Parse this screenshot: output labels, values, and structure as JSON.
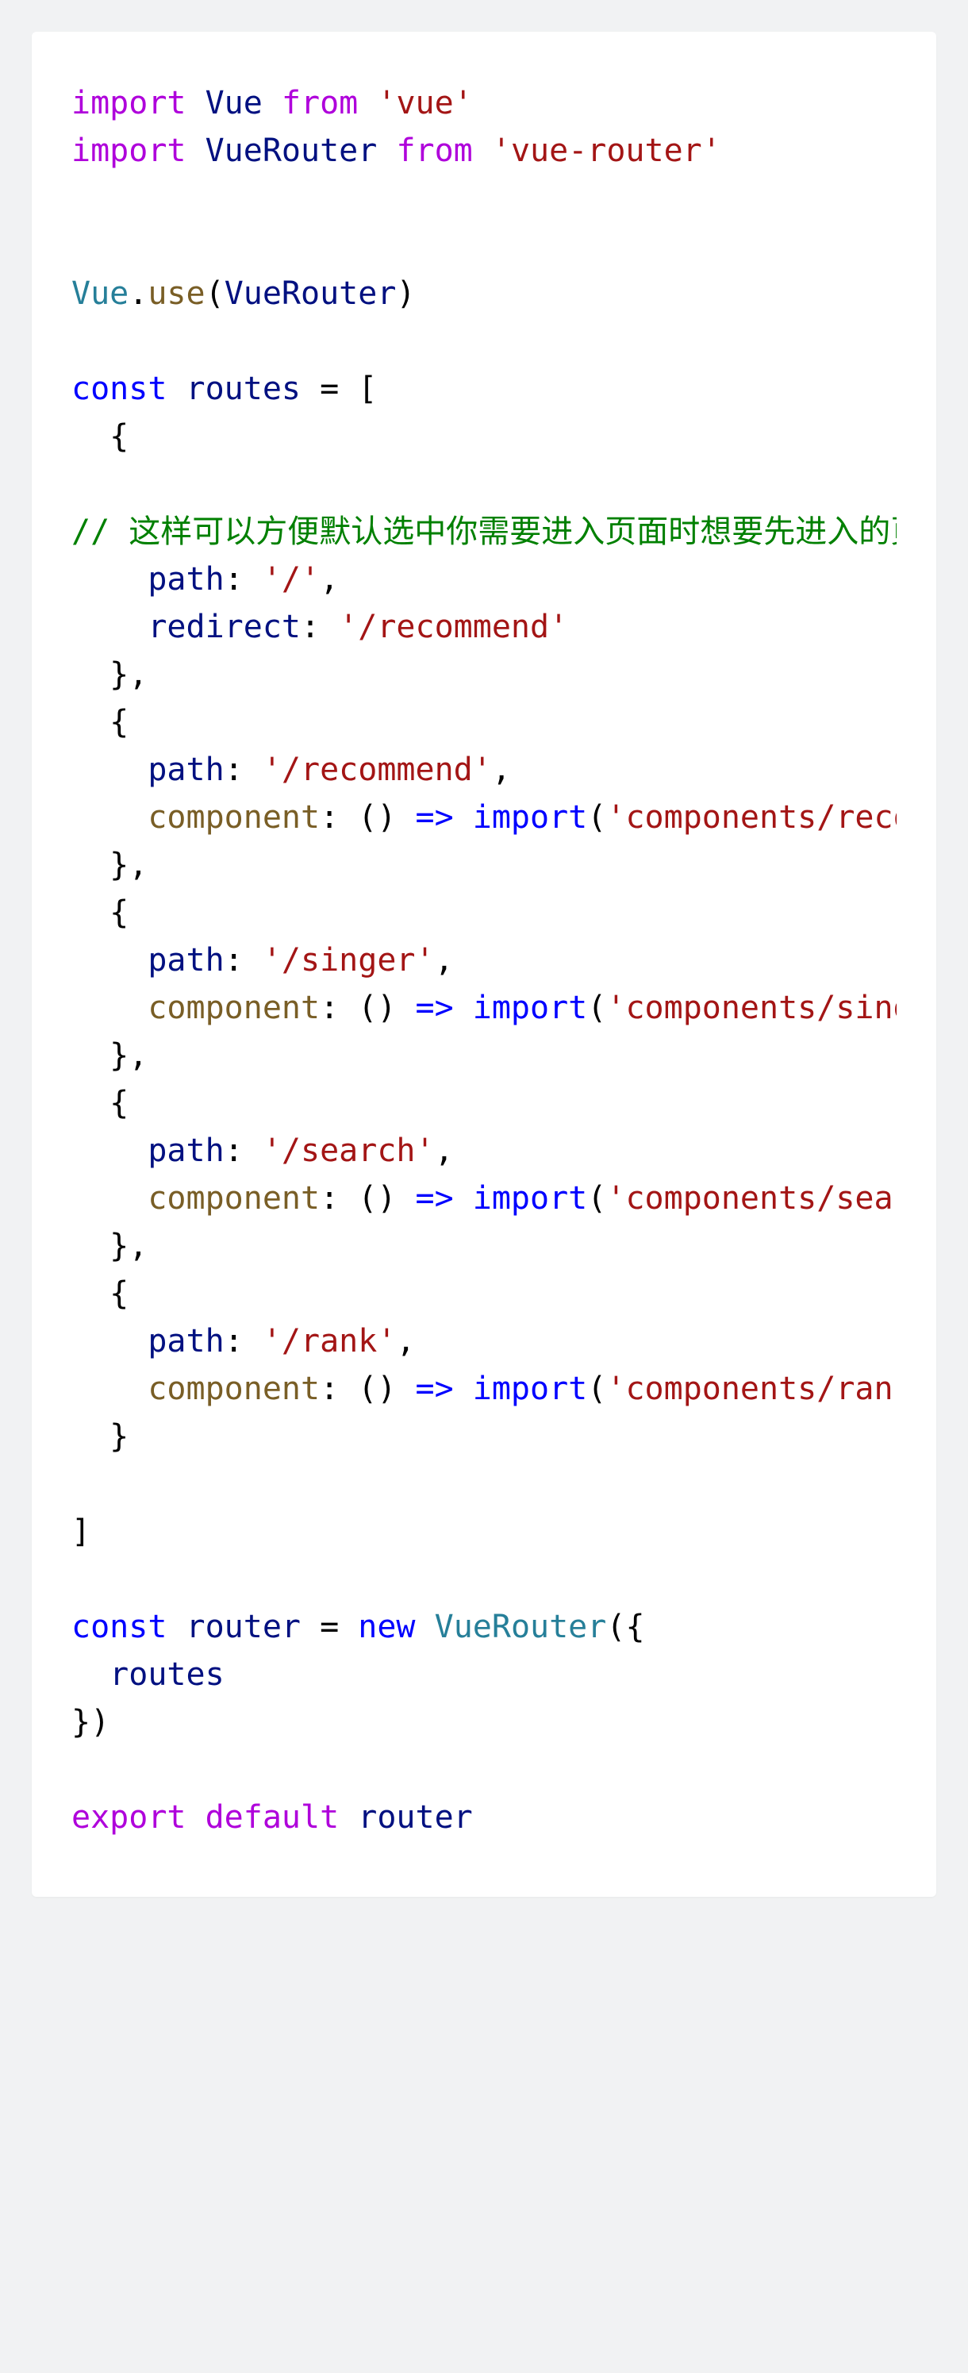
{
  "code": {
    "tokens": [
      {
        "c": "kw-import",
        "t": "import"
      },
      {
        "t": " "
      },
      {
        "c": "var",
        "t": "Vue"
      },
      {
        "t": " "
      },
      {
        "c": "kw-import",
        "t": "from"
      },
      {
        "t": " "
      },
      {
        "c": "str",
        "t": "'vue'"
      },
      {
        "t": "\n"
      },
      {
        "c": "kw-import",
        "t": "import"
      },
      {
        "t": " "
      },
      {
        "c": "var",
        "t": "VueRouter"
      },
      {
        "t": " "
      },
      {
        "c": "kw-import",
        "t": "from"
      },
      {
        "t": " "
      },
      {
        "c": "str",
        "t": "'vue-router'"
      },
      {
        "t": "\n"
      },
      {
        "t": "\n"
      },
      {
        "t": "\n"
      },
      {
        "c": "class",
        "t": "Vue"
      },
      {
        "t": "."
      },
      {
        "c": "fn",
        "t": "use"
      },
      {
        "t": "("
      },
      {
        "c": "var",
        "t": "VueRouter"
      },
      {
        "t": ")"
      },
      {
        "t": "\n"
      },
      {
        "t": "\n"
      },
      {
        "c": "kw-blue",
        "t": "const"
      },
      {
        "t": " "
      },
      {
        "c": "var",
        "t": "routes"
      },
      {
        "t": " = ["
      },
      {
        "t": "\n"
      },
      {
        "t": "  {"
      },
      {
        "t": "\n"
      },
      {
        "t": "\n"
      },
      {
        "c": "cmt",
        "t": "// 这样可以方便默认选中你需要进入页面时想要先进入的页面"
      },
      {
        "t": "\n"
      },
      {
        "t": "    "
      },
      {
        "c": "var",
        "t": "path"
      },
      {
        "t": ": "
      },
      {
        "c": "str",
        "t": "'/'"
      },
      {
        "t": ","
      },
      {
        "t": "\n"
      },
      {
        "t": "    "
      },
      {
        "c": "var",
        "t": "redirect"
      },
      {
        "t": ": "
      },
      {
        "c": "str",
        "t": "'/recommend'"
      },
      {
        "t": "\n"
      },
      {
        "t": "  },"
      },
      {
        "t": "\n"
      },
      {
        "t": "  {"
      },
      {
        "t": "\n"
      },
      {
        "t": "    "
      },
      {
        "c": "var",
        "t": "path"
      },
      {
        "t": ": "
      },
      {
        "c": "str",
        "t": "'/recommend'"
      },
      {
        "t": ","
      },
      {
        "t": "\n"
      },
      {
        "t": "    "
      },
      {
        "c": "fn",
        "t": "component"
      },
      {
        "t": ": () "
      },
      {
        "c": "kw-blue",
        "t": "=>"
      },
      {
        "t": " "
      },
      {
        "c": "kw-blue",
        "t": "import"
      },
      {
        "t": "("
      },
      {
        "c": "str",
        "t": "'components/recommend/recommend'"
      },
      {
        "t": ")"
      },
      {
        "t": "\n"
      },
      {
        "t": "  },"
      },
      {
        "t": "\n"
      },
      {
        "t": "  {"
      },
      {
        "t": "\n"
      },
      {
        "t": "    "
      },
      {
        "c": "var",
        "t": "path"
      },
      {
        "t": ": "
      },
      {
        "c": "str",
        "t": "'/singer'"
      },
      {
        "t": ","
      },
      {
        "t": "\n"
      },
      {
        "t": "    "
      },
      {
        "c": "fn",
        "t": "component"
      },
      {
        "t": ": () "
      },
      {
        "c": "kw-blue",
        "t": "=>"
      },
      {
        "t": " "
      },
      {
        "c": "kw-blue",
        "t": "import"
      },
      {
        "t": "("
      },
      {
        "c": "str",
        "t": "'components/singer/singer'"
      },
      {
        "t": ")"
      },
      {
        "t": "\n"
      },
      {
        "t": "  },"
      },
      {
        "t": "\n"
      },
      {
        "t": "  {"
      },
      {
        "t": "\n"
      },
      {
        "t": "    "
      },
      {
        "c": "var",
        "t": "path"
      },
      {
        "t": ": "
      },
      {
        "c": "str",
        "t": "'/search'"
      },
      {
        "t": ","
      },
      {
        "t": "\n"
      },
      {
        "t": "    "
      },
      {
        "c": "fn",
        "t": "component"
      },
      {
        "t": ": () "
      },
      {
        "c": "kw-blue",
        "t": "=>"
      },
      {
        "t": " "
      },
      {
        "c": "kw-blue",
        "t": "import"
      },
      {
        "t": "("
      },
      {
        "c": "str",
        "t": "'components/search/search'"
      },
      {
        "t": ")"
      },
      {
        "t": "\n"
      },
      {
        "t": "  },"
      },
      {
        "t": "\n"
      },
      {
        "t": "  {"
      },
      {
        "t": "\n"
      },
      {
        "t": "    "
      },
      {
        "c": "var",
        "t": "path"
      },
      {
        "t": ": "
      },
      {
        "c": "str",
        "t": "'/rank'"
      },
      {
        "t": ","
      },
      {
        "t": "\n"
      },
      {
        "t": "    "
      },
      {
        "c": "fn",
        "t": "component"
      },
      {
        "t": ": () "
      },
      {
        "c": "kw-blue",
        "t": "=>"
      },
      {
        "t": " "
      },
      {
        "c": "kw-blue",
        "t": "import"
      },
      {
        "t": "("
      },
      {
        "c": "str",
        "t": "'components/rank/rank'"
      },
      {
        "t": ")"
      },
      {
        "t": "\n"
      },
      {
        "t": "  }"
      },
      {
        "t": "\n"
      },
      {
        "t": "\n"
      },
      {
        "t": "]"
      },
      {
        "t": "\n"
      },
      {
        "t": "\n"
      },
      {
        "c": "kw-blue",
        "t": "const"
      },
      {
        "t": " "
      },
      {
        "c": "var",
        "t": "router"
      },
      {
        "t": " = "
      },
      {
        "c": "kw-blue",
        "t": "new"
      },
      {
        "t": " "
      },
      {
        "c": "class",
        "t": "VueRouter"
      },
      {
        "t": "({"
      },
      {
        "t": "\n"
      },
      {
        "t": "  "
      },
      {
        "c": "var",
        "t": "routes"
      },
      {
        "t": "\n"
      },
      {
        "t": "})"
      },
      {
        "t": "\n"
      },
      {
        "t": "\n"
      },
      {
        "c": "kw-import",
        "t": "export"
      },
      {
        "t": " "
      },
      {
        "c": "kw-import",
        "t": "default"
      },
      {
        "t": " "
      },
      {
        "c": "var",
        "t": "router"
      },
      {
        "t": "\n"
      }
    ]
  }
}
